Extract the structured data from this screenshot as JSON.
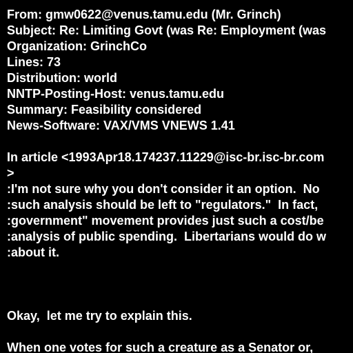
{
  "theme": {
    "background": "#000000",
    "text": "#ffffff"
  },
  "header": {
    "from": "From: gmw0622@venus.tamu.edu (Mr. Grinch)",
    "subject": "Subject: Re: Limiting Govt (was Re: Employment (was",
    "organization": "Organization: GrinchCo",
    "lines": "Lines: 73",
    "distribution": "Distribution: world",
    "nntp_posting_host": "NNTP-Posting-Host: venus.tamu.edu",
    "summary": "Summary: Feasibility considered",
    "news_software": "News-Software: VAX/VMS VNEWS 1.41"
  },
  "body": {
    "attribution": "In article <1993Apr18.174237.11229@isc-br.isc-br.com",
    "quote_marker": ">",
    "quoted": [
      ":I'm not sure why you don't consider it an option.  No",
      ":such analysis should be left to \"regulators.\"  In fact,",
      ":government\" movement provides just such a cost/be",
      ":analysis of public spending.  Libertarians would do w",
      ":about it."
    ],
    "reply": [
      "Okay,  let me try to explain this.",
      "When one votes for such a creature as a Senator or,"
    ]
  }
}
